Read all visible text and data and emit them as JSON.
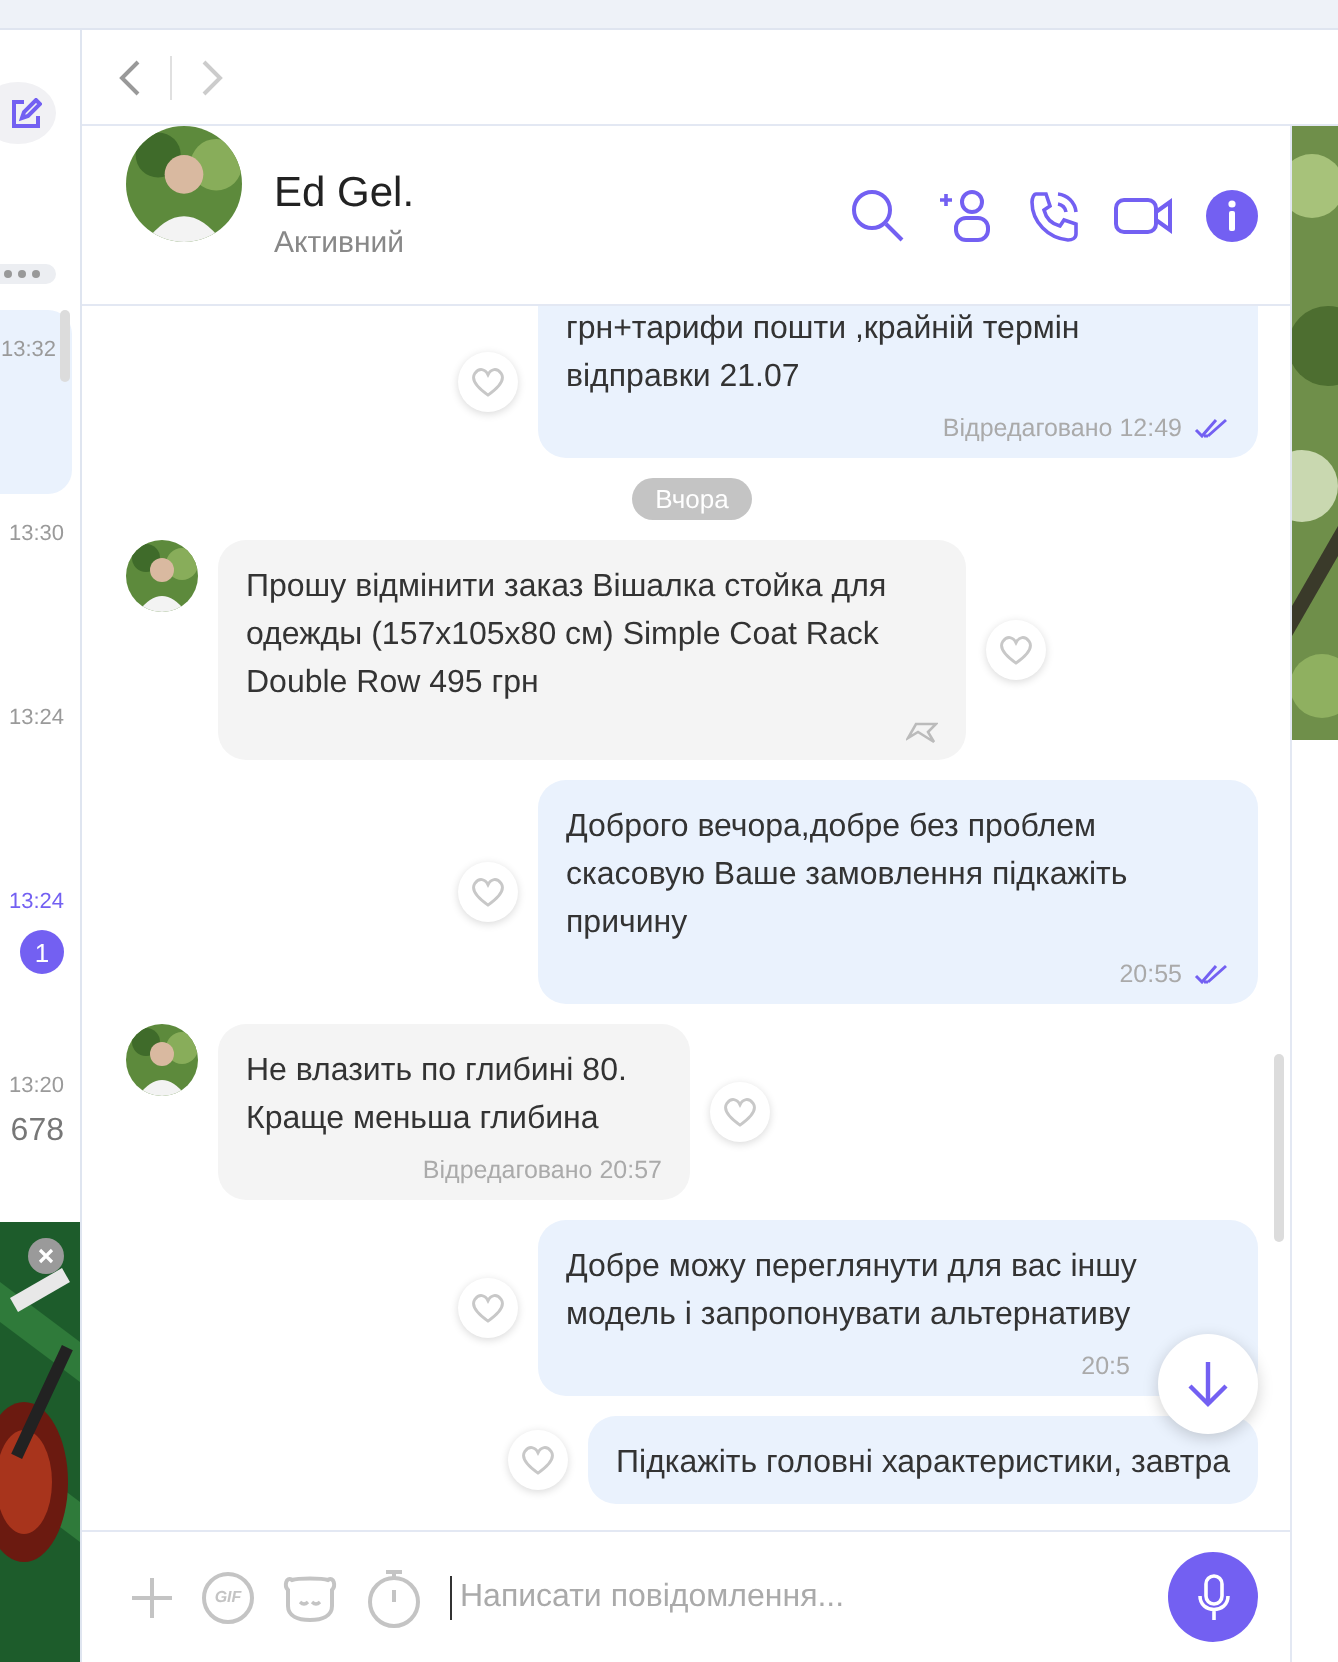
{
  "sidebar": {
    "items": [
      {
        "time": "13:32",
        "selected": true
      },
      {
        "time": "13:30",
        "selected": false
      },
      {
        "time": "13:24",
        "selected": false
      },
      {
        "time": "13:24",
        "selected": false,
        "badge": "1"
      },
      {
        "time": "13:20",
        "selected": false,
        "preview": "678"
      }
    ]
  },
  "chat": {
    "name": "Ed Gel.",
    "status": "Активний"
  },
  "messages": [
    {
      "kind": "outgoing",
      "text": "грн+тарифи пошти ,крайній термін відправки 21.07",
      "meta": "Відредаговано 12:49",
      "read": true
    },
    {
      "kind": "date",
      "text": "Вчора"
    },
    {
      "kind": "incoming",
      "text": "Прошу відмінити заказ Вішалка стойка для одежды (157x105x80 см) Simple Coat Rack Double Row  495 грн",
      "replyable": true
    },
    {
      "kind": "outgoing",
      "text": "Доброго вечора,добре без проблем скасовую Ваше замовлення підкажіть причину",
      "meta": "20:55",
      "read": true
    },
    {
      "kind": "incoming",
      "text": "Не влазить по глибині 80. Краще  меньша глибина",
      "meta": "Відредаговано 20:57",
      "replyable": false
    },
    {
      "kind": "outgoing",
      "text": "Добре можу переглянути для вас іншу модель і запропонувати альтернативу",
      "meta": "20:5"
    },
    {
      "kind": "outgoing",
      "text": "Підкажіть головні характеристики, завтра"
    }
  ],
  "composer": {
    "gif_label": "GIF",
    "placeholder": "Написати повідомлення..."
  }
}
